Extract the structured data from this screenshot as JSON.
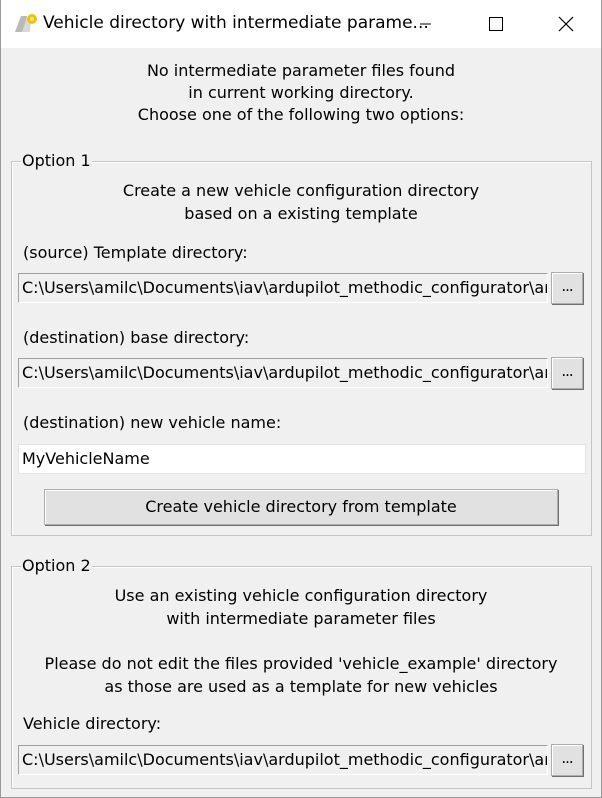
{
  "window": {
    "title": "Vehicle directory with intermediate parame...",
    "icon": "ardupilot-app-icon",
    "controls": {
      "minimize_icon": "minimize-icon",
      "maximize_icon": "maximize-icon",
      "close_icon": "close-icon"
    }
  },
  "intro": {
    "line1": "No intermediate parameter files found",
    "line2": "in current working directory.",
    "line3": "Choose one of the following two options:"
  },
  "option1": {
    "legend": "Option 1",
    "desc_line1": "Create a new vehicle configuration directory",
    "desc_line2": "based on a existing template",
    "source_label": "(source) Template directory:",
    "source_value": "C:\\Users\\amilc\\Documents\\iav\\ardupilot_methodic_configurator\\ardupilot_methodic_configurator\\vehicle_templates",
    "source_browse_label": "...",
    "dest_label": "(destination) base directory:",
    "dest_value": "C:\\Users\\amilc\\Documents\\iav\\ardupilot_methodic_configurator\\ardupilot_methodic_configurator\\vehicles",
    "dest_browse_label": "...",
    "name_label": "(destination) new vehicle name:",
    "name_value": "MyVehicleName",
    "create_button_label": "Create vehicle directory from template"
  },
  "option2": {
    "legend": "Option 2",
    "desc_line1": "Use an existing vehicle configuration directory",
    "desc_line2": "with intermediate parameter files",
    "note_line1": "Please do not edit the files provided 'vehicle_example' directory",
    "note_line2": "as those are used as a template for new vehicles",
    "vehicle_label": "Vehicle directory:",
    "vehicle_value": "C:\\Users\\amilc\\Documents\\iav\\ardupilot_methodic_configurator\\ardupilot_methodic_configurator\\vehicle_example",
    "vehicle_browse_label": "..."
  },
  "colors": {
    "window_bg": "#f0f0f0",
    "titlebar_bg": "#ffffff",
    "button_bg": "#e1e1e1",
    "border": "#adadad"
  }
}
